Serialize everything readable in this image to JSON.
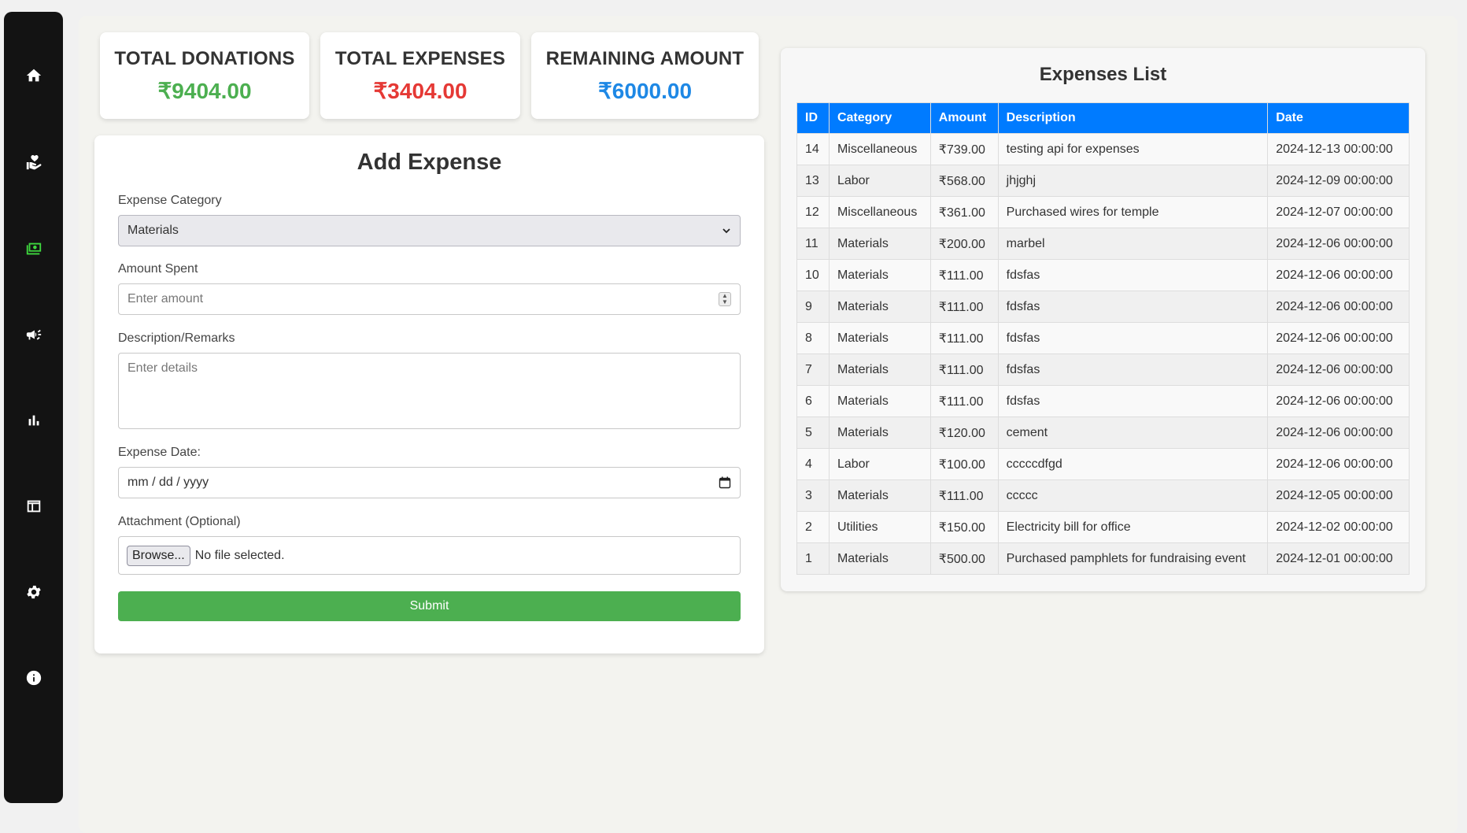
{
  "sidebar": {
    "items": [
      {
        "name": "home-icon"
      },
      {
        "name": "donation-icon"
      },
      {
        "name": "expenses-icon"
      },
      {
        "name": "campaign-icon"
      },
      {
        "name": "reports-icon"
      },
      {
        "name": "table-icon"
      },
      {
        "name": "settings-icon"
      },
      {
        "name": "info-icon"
      }
    ],
    "active_index": 2,
    "active_color": "#3ed83e"
  },
  "stats": {
    "donations": {
      "label": "TOTAL DONATIONS",
      "value": "₹9404.00",
      "color": "#4caf50"
    },
    "expenses": {
      "label": "TOTAL EXPENSES",
      "value": "₹3404.00",
      "color": "#e53935"
    },
    "remaining": {
      "label": "REMAINING AMOUNT",
      "value": "₹6000.00",
      "color": "#1e88e5"
    }
  },
  "form": {
    "title": "Add Expense",
    "category_label": "Expense Category",
    "category_value": "Materials",
    "amount_label": "Amount Spent",
    "amount_placeholder": "Enter amount",
    "description_label": "Description/Remarks",
    "description_placeholder": "Enter details",
    "date_label": "Expense Date:",
    "date_value": "mm / dd / yyyy",
    "attachment_label": "Attachment (Optional)",
    "browse_label": "Browse...",
    "file_status": "No file selected.",
    "submit_label": "Submit"
  },
  "expenses_list": {
    "title": "Expenses List",
    "columns": [
      "ID",
      "Category",
      "Amount",
      "Description",
      "Date"
    ],
    "rows": [
      [
        "14",
        "Miscellaneous",
        "₹739.00",
        "testing api for expenses",
        "2024-12-13 00:00:00"
      ],
      [
        "13",
        "Labor",
        "₹568.00",
        "jhjghj",
        "2024-12-09 00:00:00"
      ],
      [
        "12",
        "Miscellaneous",
        "₹361.00",
        "Purchased wires for temple",
        "2024-12-07 00:00:00"
      ],
      [
        "11",
        "Materials",
        "₹200.00",
        "marbel",
        "2024-12-06 00:00:00"
      ],
      [
        "10",
        "Materials",
        "₹111.00",
        "fdsfas",
        "2024-12-06 00:00:00"
      ],
      [
        "9",
        "Materials",
        "₹111.00",
        "fdsfas",
        "2024-12-06 00:00:00"
      ],
      [
        "8",
        "Materials",
        "₹111.00",
        "fdsfas",
        "2024-12-06 00:00:00"
      ],
      [
        "7",
        "Materials",
        "₹111.00",
        "fdsfas",
        "2024-12-06 00:00:00"
      ],
      [
        "6",
        "Materials",
        "₹111.00",
        "fdsfas",
        "2024-12-06 00:00:00"
      ],
      [
        "5",
        "Materials",
        "₹120.00",
        "cement",
        "2024-12-06 00:00:00"
      ],
      [
        "4",
        "Labor",
        "₹100.00",
        "cccccdfgd",
        "2024-12-06 00:00:00"
      ],
      [
        "3",
        "Materials",
        "₹111.00",
        "ccccc",
        "2024-12-05 00:00:00"
      ],
      [
        "2",
        "Utilities",
        "₹150.00",
        "Electricity bill for office",
        "2024-12-02 00:00:00"
      ],
      [
        "1",
        "Materials",
        "₹500.00",
        "Purchased pamphlets for fundraising event",
        "2024-12-01 00:00:00"
      ]
    ],
    "header_color": "#007bff"
  }
}
